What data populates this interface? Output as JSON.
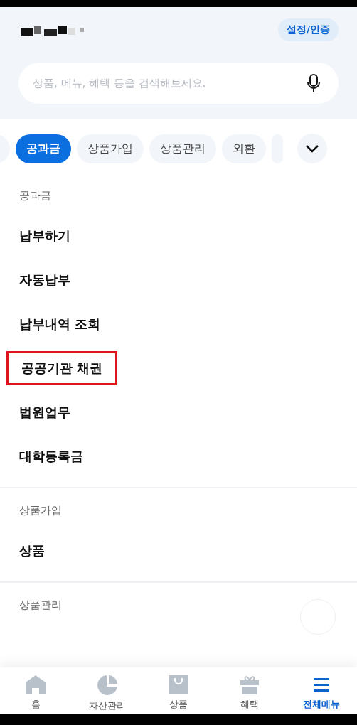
{
  "header": {
    "settings_button": "설정/인증",
    "search": {
      "placeholder": "상품, 메뉴, 혜택 등을 검색해보세요."
    }
  },
  "chips": [
    {
      "label": "공과금",
      "selected": true
    },
    {
      "label": "상품가입",
      "selected": false
    },
    {
      "label": "상품관리",
      "selected": false
    },
    {
      "label": "외환",
      "selected": false
    }
  ],
  "sections": [
    {
      "title": "공과금",
      "items": [
        {
          "label": "납부하기",
          "highlighted": false
        },
        {
          "label": "자동납부",
          "highlighted": false
        },
        {
          "label": "납부내역 조회",
          "highlighted": false
        },
        {
          "label": "공공기관 채권",
          "highlighted": true
        },
        {
          "label": "법원업무",
          "highlighted": false
        },
        {
          "label": "대학등록금",
          "highlighted": false
        }
      ]
    },
    {
      "title": "상품가입",
      "items": [
        {
          "label": "상품",
          "highlighted": false
        }
      ]
    },
    {
      "title": "상품관리"
    }
  ],
  "bottom_nav": [
    {
      "label": "홈",
      "selected": false
    },
    {
      "label": "자산관리",
      "selected": false
    },
    {
      "label": "상품",
      "selected": false
    },
    {
      "label": "혜택",
      "selected": false
    },
    {
      "label": "전체메뉴",
      "selected": true
    }
  ]
}
